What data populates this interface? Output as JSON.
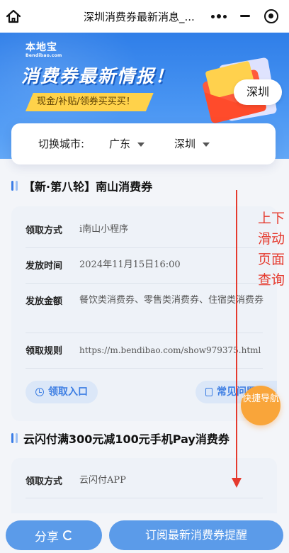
{
  "topbar": {
    "title": "深圳消费券最新消息_...",
    "icons": {
      "home": "home-icon",
      "more": "more-dots-icon",
      "minimize": "minimize-icon",
      "close": "close-target-icon"
    }
  },
  "banner": {
    "brand": "本地宝",
    "brand_sub": "Bendibao.com",
    "title": "消费券最新情报！",
    "tag": "现金/补贴/领券买买买！",
    "city": "深圳"
  },
  "city_switch": {
    "label": "切换城市:",
    "province": "广东",
    "city": "深圳"
  },
  "sections": [
    {
      "title": "【新·第八轮】南山消费券",
      "rows": [
        {
          "label": "领取方式",
          "value": "i南山小程序"
        },
        {
          "label": "发放时间",
          "value": "2024年11月15日16:00"
        },
        {
          "label": "发放金额",
          "value": "餐饮类消费券、零售类消费券、住宿类消费券"
        },
        {
          "label": "领取规则",
          "value": "https://m.bendibao.com/show979375.html"
        }
      ],
      "buttons": {
        "entry": "领取入口",
        "faq": "常见问题"
      }
    },
    {
      "title": "云闪付满300元减100元手机Pay消费券",
      "rows": [
        {
          "label": "领取方式",
          "value": "云闪付APP"
        }
      ]
    }
  ],
  "overlay": {
    "scroll_hint": "上下滑动页面查询",
    "quick_nav": "快捷导航"
  },
  "bottom": {
    "share": "分享",
    "subscribe": "订阅最新消费券提醒"
  },
  "colors": {
    "accent": "#3d7ee3",
    "banner": "#2f7ee8",
    "hint_red": "#e53a2e",
    "quick_nav": "#f9a53a"
  }
}
